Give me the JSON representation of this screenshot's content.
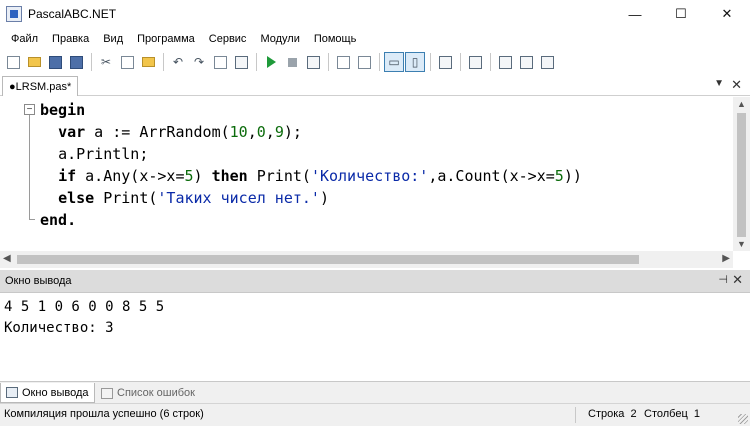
{
  "window": {
    "title": "PascalABC.NET",
    "minimize_glyph": "—",
    "maximize_glyph": "☐",
    "close_glyph": "✕"
  },
  "menu": [
    "Файл",
    "Правка",
    "Вид",
    "Программа",
    "Сервис",
    "Модули",
    "Помощь"
  ],
  "toolbar": {
    "buttons": [
      "new-file-icon",
      "open-folder-icon",
      "save-icon",
      "save-all-icon",
      "cut-icon",
      "copy-icon",
      "paste-icon",
      "undo-icon",
      "redo-icon",
      "format-icon",
      "run-icon",
      "stop-icon",
      "debug-icon"
    ]
  },
  "editor_tab": {
    "label": "●LRSM.pas*"
  },
  "code": {
    "fold_marker": "−",
    "lines": [
      {
        "indent": "",
        "segments": [
          {
            "t": "begin",
            "c": "kw"
          }
        ]
      },
      {
        "indent": "  ",
        "segments": [
          {
            "t": "var",
            "c": "kw"
          },
          {
            "t": " a := ArrRandom(",
            "c": ""
          },
          {
            "t": "10",
            "c": "num"
          },
          {
            "t": ",",
            "c": ""
          },
          {
            "t": "0",
            "c": "num"
          },
          {
            "t": ",",
            "c": ""
          },
          {
            "t": "9",
            "c": "num"
          },
          {
            "t": ");",
            "c": ""
          }
        ]
      },
      {
        "indent": "  ",
        "segments": [
          {
            "t": "a.Println;",
            "c": ""
          }
        ]
      },
      {
        "indent": "  ",
        "segments": [
          {
            "t": "if",
            "c": "kw"
          },
          {
            "t": " a.Any(x->x=",
            "c": ""
          },
          {
            "t": "5",
            "c": "num"
          },
          {
            "t": ") ",
            "c": ""
          },
          {
            "t": "then",
            "c": "kw"
          },
          {
            "t": " Print(",
            "c": ""
          },
          {
            "t": "'Количество:'",
            "c": "str"
          },
          {
            "t": ",a.Count(x->x=",
            "c": ""
          },
          {
            "t": "5",
            "c": "num"
          },
          {
            "t": "))",
            "c": ""
          }
        ]
      },
      {
        "indent": "  ",
        "segments": [
          {
            "t": "else",
            "c": "kw"
          },
          {
            "t": " Print(",
            "c": ""
          },
          {
            "t": "'Таких чисел нет.'",
            "c": "str"
          },
          {
            "t": ")",
            "c": ""
          }
        ]
      },
      {
        "indent": "",
        "segments": [
          {
            "t": "end.",
            "c": "kw"
          }
        ]
      }
    ]
  },
  "output_panel": {
    "title": "Окно вывода",
    "pin_glyph": "⊣",
    "close_glyph": "✕",
    "lines": [
      "4 5 1 0 6 0 0 8 5 5",
      "Количество: 3"
    ]
  },
  "bottom_tabs": [
    {
      "label": "Окно вывода",
      "active": true
    },
    {
      "label": "Список ошибок",
      "active": false
    }
  ],
  "status": {
    "message": "Компиляция прошла успешно (6 строк)",
    "row_label": "Строка",
    "row_value": "2",
    "col_label": "Столбец",
    "col_value": "1"
  },
  "colors": {
    "keyword": "#000000",
    "number": "#0b6b0b",
    "string": "#0a2aa8",
    "panel_header": "#dcdcdc"
  }
}
